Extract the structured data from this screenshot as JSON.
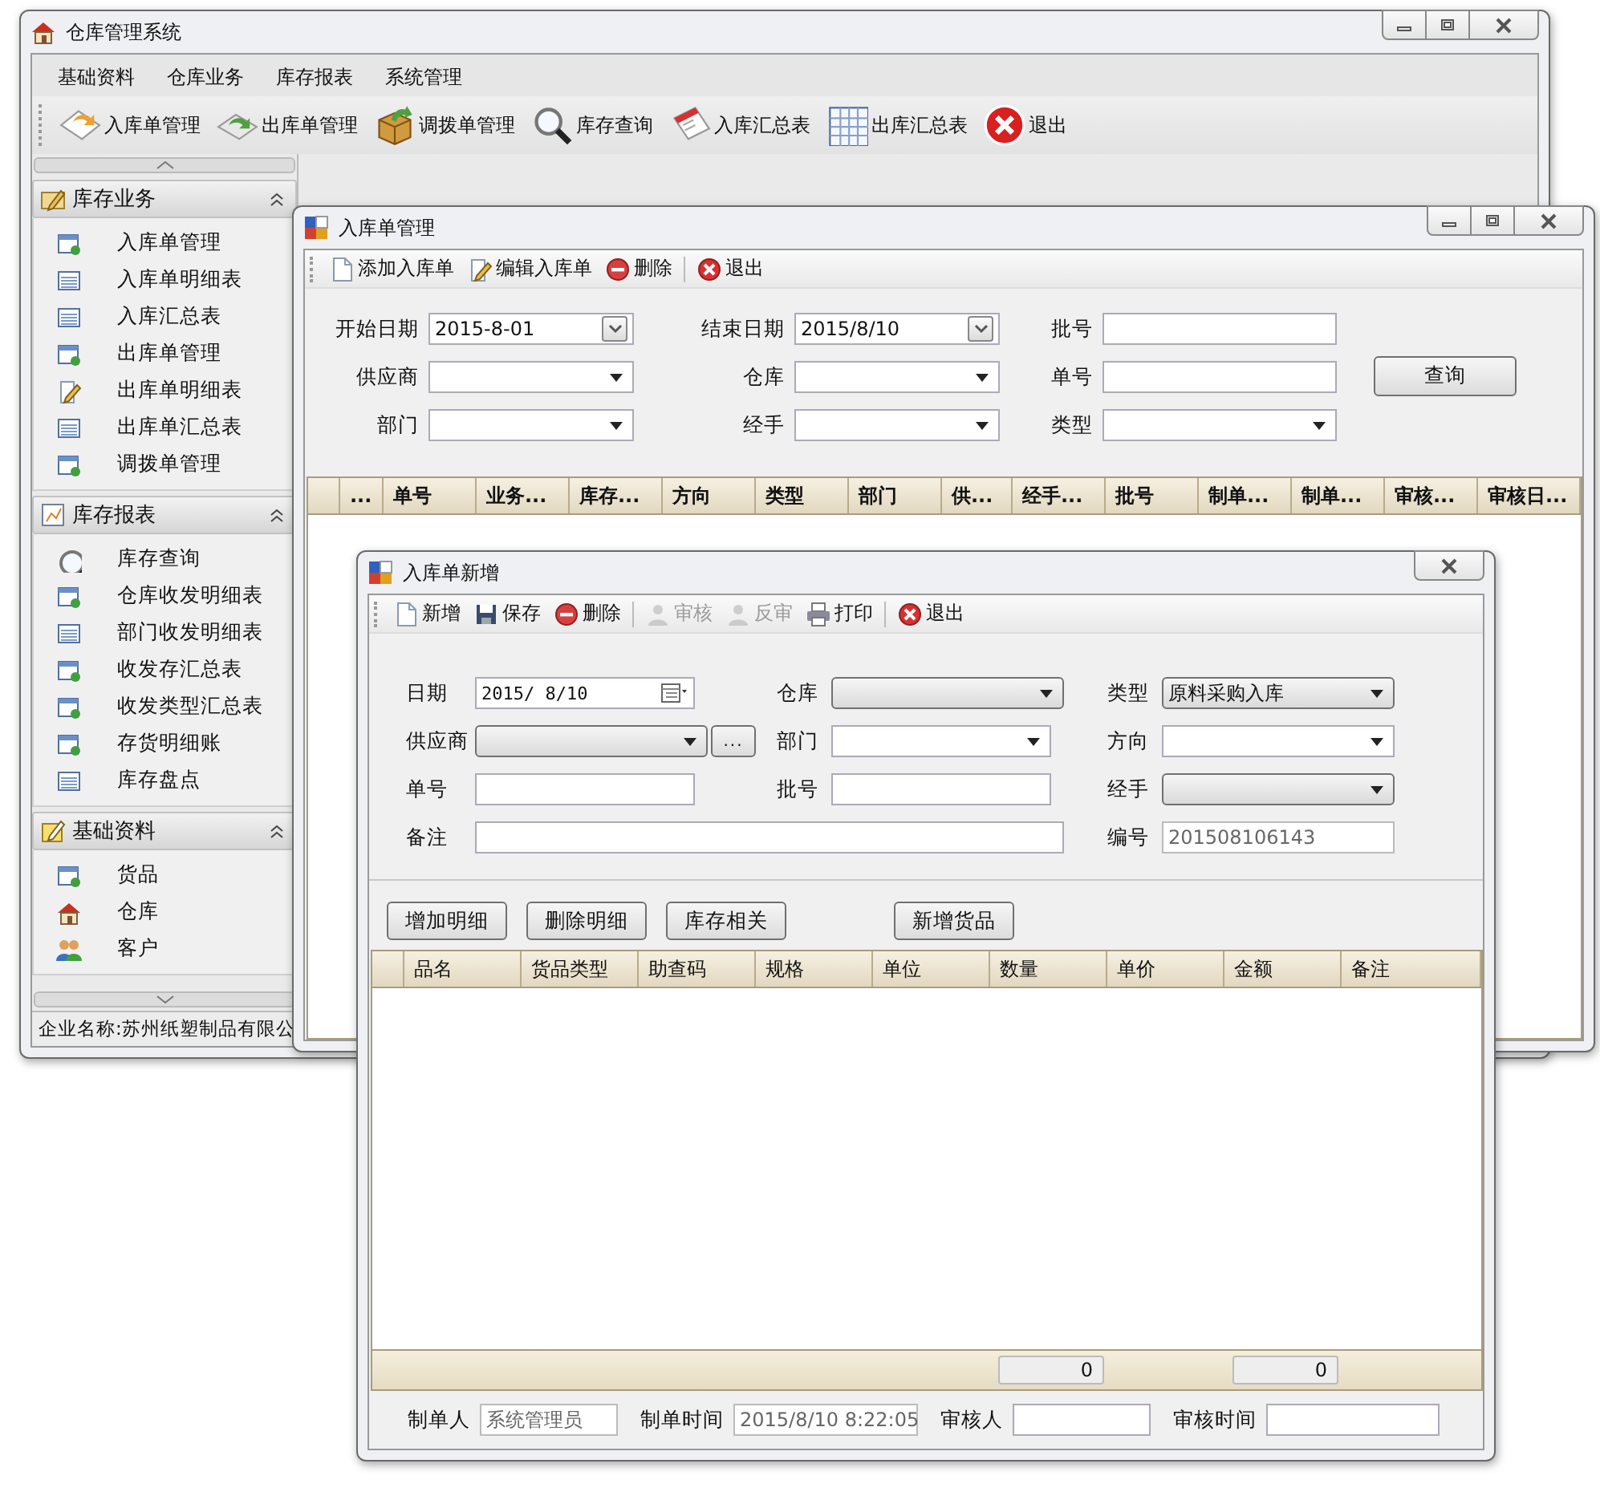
{
  "main_window": {
    "title": "仓库管理系统",
    "menu": [
      "基础资料",
      "仓库业务",
      "库存报表",
      "系统管理"
    ],
    "toolbar": [
      "入库单管理",
      "出库单管理",
      "调拨单管理",
      "库存查询",
      "入库汇总表",
      "出库汇总表",
      "退出"
    ],
    "sidebar": [
      {
        "title": "库存业务",
        "expanded": true,
        "items": [
          "入库单管理",
          "入库单明细表",
          "入库汇总表",
          "出库单管理",
          "出库单明细表",
          "出库单汇总表",
          "调拨单管理"
        ]
      },
      {
        "title": "库存报表",
        "expanded": true,
        "items": [
          "库存查询",
          "仓库收发明细表",
          "部门收发明细表",
          "收发存汇总表",
          "收发类型汇总表",
          "存货明细账",
          "库存盘点"
        ]
      },
      {
        "title": "基础资料",
        "expanded": true,
        "items": [
          "货品",
          "仓库",
          "客户"
        ]
      }
    ],
    "status_bar": "企业名称:苏州纸塑制品有限公"
  },
  "list_window": {
    "title": "入库单管理",
    "toolbar": [
      "添加入库单",
      "编辑入库单",
      "删除",
      "退出"
    ],
    "filters": [
      {
        "label": "开始日期",
        "kind": "date",
        "value": "2015-8-01"
      },
      {
        "label": "结束日期",
        "kind": "date",
        "value": "2015/8/10"
      },
      {
        "label": "批号",
        "kind": "text"
      },
      {
        "label": "供应商",
        "kind": "combo"
      },
      {
        "label": "仓库",
        "kind": "combo"
      },
      {
        "label": "单号",
        "kind": "text"
      },
      {
        "label": "部门",
        "kind": "combo"
      },
      {
        "label": "经手",
        "kind": "combo"
      },
      {
        "label": "类型",
        "kind": "combo"
      }
    ],
    "query_button": "查询",
    "columns": [
      "...",
      "单号",
      "业务...",
      "库存...",
      "方向",
      "类型",
      "部门",
      "供...",
      "经手...",
      "批号",
      "制单...",
      "制单...",
      "审核...",
      "审核日..."
    ]
  },
  "edit_window": {
    "title": "入库单新增",
    "toolbar": [
      {
        "label": "新增",
        "disabled": false
      },
      {
        "label": "保存",
        "disabled": false
      },
      {
        "label": "删除",
        "disabled": false
      },
      {
        "label": "审核",
        "disabled": true
      },
      {
        "label": "反审",
        "disabled": true
      },
      {
        "label": "打印",
        "disabled": false
      },
      {
        "label": "退出",
        "disabled": false
      }
    ],
    "form_rows": [
      [
        {
          "label": "日期",
          "kind": "date-picker",
          "value": "2015/ 8/10"
        },
        {
          "label": "仓库",
          "kind": "button-combo"
        },
        {
          "label": "类型",
          "kind": "button-combo",
          "value": "原料采购入库"
        }
      ],
      [
        {
          "label": "供应商",
          "kind": "button-combo",
          "browse": "..."
        },
        {
          "label": "部门",
          "kind": "combo"
        },
        {
          "label": "方向",
          "kind": "combo"
        }
      ],
      [
        {
          "label": "单号",
          "kind": "text"
        },
        {
          "label": "批号",
          "kind": "text"
        },
        {
          "label": "经手",
          "kind": "button-combo"
        }
      ],
      [
        {
          "label": "备注",
          "kind": "text"
        },
        {
          "label": "编号",
          "kind": "readonly",
          "value": "201508106143"
        }
      ]
    ],
    "buttons": [
      "增加明细",
      "删除明细",
      "库存相关",
      "新增货品"
    ],
    "columns": [
      {
        "label": "品名"
      },
      {
        "label": "货品类型"
      },
      {
        "label": "助查码"
      },
      {
        "label": "规格"
      },
      {
        "label": "单位"
      },
      {
        "label": "数量",
        "total": "0"
      },
      {
        "label": "单价"
      },
      {
        "label": "金额",
        "total": "0"
      },
      {
        "label": "备注"
      }
    ],
    "footer": [
      {
        "label": "制单人",
        "kind": "readonly",
        "value": "系统管理员"
      },
      {
        "label": "制单时间",
        "kind": "readonly",
        "value": "2015/8/10 8:22:05"
      },
      {
        "label": "审核人",
        "kind": "text"
      },
      {
        "label": "审核时间",
        "kind": "text"
      }
    ]
  }
}
